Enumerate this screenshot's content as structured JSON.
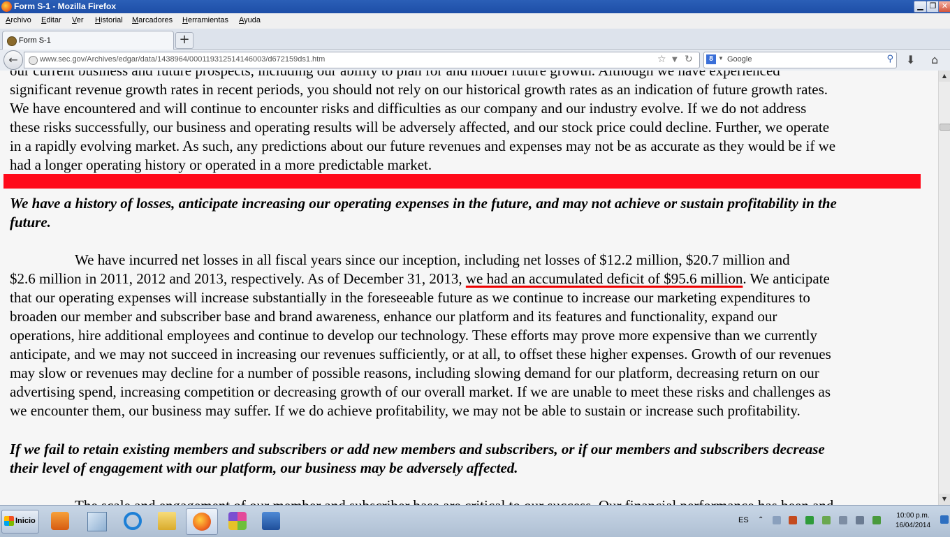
{
  "window": {
    "title": "Form S-1 - Mozilla Firefox"
  },
  "menu": [
    "Archivo",
    "Editar",
    "Ver",
    "Historial",
    "Marcadores",
    "Herramientas",
    "Ayuda"
  ],
  "tab": {
    "title": "Form S-1",
    "new_tab_symbol": "+"
  },
  "nav": {
    "url": "www.sec.gov/Archives/edgar/data/1438964/000119312514146003/d672159ds1.htm",
    "search_placeholder": "Google"
  },
  "document": {
    "para1": [
      "our current business and future prospects, including our ability to plan for and model future growth. Although we have experienced",
      "significant revenue growth rates in recent periods, you should not rely on our historical growth rates as an indication of future growth rates.",
      "We have encountered and will continue to encounter risks and difficulties as our company and our industry evolve. If we do not address",
      "these risks successfully, our business and operating results will be adversely affected, and our stock price could decline. Further, we operate",
      "in a rapidly evolving market. As such, any predictions about our future revenues and expenses may not be as accurate as they would be if we",
      "had a longer operating history or operated in a more predictable market."
    ],
    "heading1": [
      "We have a history of losses, anticipate increasing our operating expenses in the future, and may not achieve or sustain profitability in the",
      "future."
    ],
    "para2_first": "We have incurred net losses in all fiscal years since our inception, including net losses of $12.2 million, $20.7 million and",
    "para2_second_pre": "$2.6 million in 2011, 2012 and 2013, respectively. As of December 31, 2013, ",
    "para2_second_highlight": "we had an accumulated deficit of $95.6 million",
    "para2_second_post": ". We anticipate",
    "para2_rest": [
      "that our operating expenses will increase substantially in the foreseeable future as we continue to increase our marketing expenditures to",
      "broaden our member and subscriber base and brand awareness, enhance our platform and its features and functionality, expand our",
      "operations, hire additional employees and continue to develop our technology. These efforts may prove more expensive than we currently",
      "anticipate, and we may not succeed in increasing our revenues sufficiently, or at all, to offset these higher expenses. Growth of our revenues",
      "may slow or revenues may decline for a number of possible reasons, including slowing demand for our platform, decreasing return on our",
      "advertising spend, increasing competition or decreasing growth of our overall market. If we are unable to meet these risks and challenges as",
      "we encounter them, our business may suffer. If we do achieve profitability, we may not be able to sustain or increase such profitability."
    ],
    "heading2": [
      "If we fail to retain existing members and subscribers or add new members and subscribers, or if our members and subscribers decrease",
      "their level of engagement with our platform, our business may be adversely affected."
    ],
    "para3_partial": "The scale and engagement of our member and subscriber base are critical to our success. Our financial performance has been and"
  },
  "taskbar": {
    "start_label": "Inicio",
    "language": "ES",
    "time": "10:00 p.m.",
    "date": "16/04/2014"
  },
  "colors": {
    "highlight_bar": "#ff0a1a",
    "underline": "#e00000",
    "titlebar": "#1d4ea7"
  }
}
